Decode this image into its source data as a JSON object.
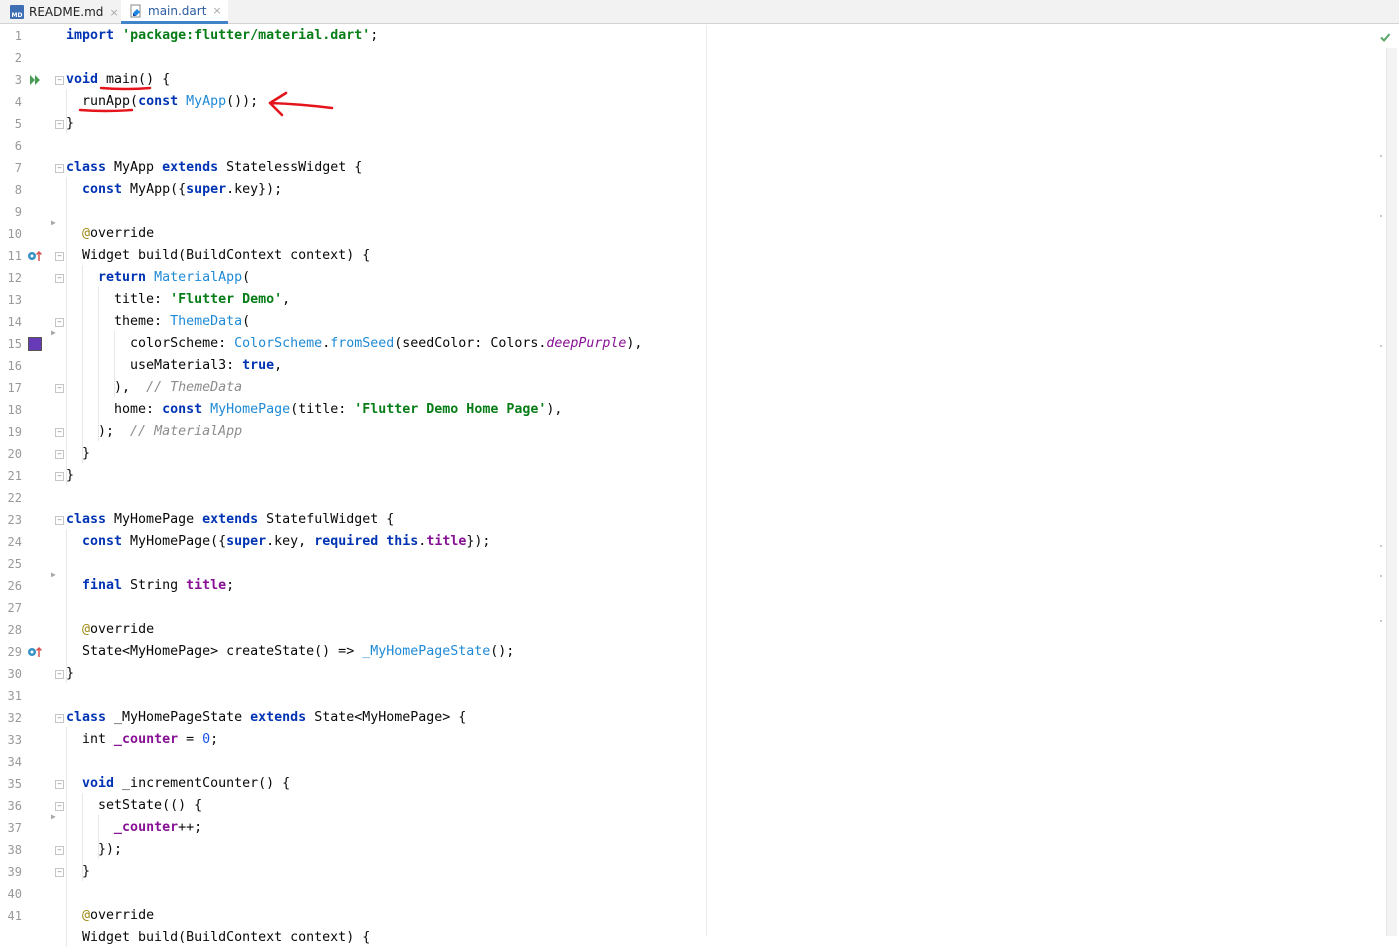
{
  "tabs": [
    {
      "label": "README.md",
      "icon": "markdown-file-icon",
      "active": false
    },
    {
      "label": "main.dart",
      "icon": "dart-file-icon",
      "active": true
    }
  ],
  "tab_close_glyph": "×",
  "editor": {
    "status": "no-problems-check-icon",
    "color_swatch": "#673ab7",
    "accent": "#4083c9"
  },
  "line_numbers": [
    "1",
    "2",
    "3",
    "4",
    "5",
    "6",
    "7",
    "8",
    "9",
    "10",
    "11",
    "12",
    "13",
    "14",
    "15",
    "16",
    "17",
    "18",
    "19",
    "20",
    "21",
    "22",
    "23",
    "24",
    "25",
    "26",
    "27",
    "28",
    "29",
    "30",
    "31",
    "32",
    "33",
    "34",
    "35",
    "36",
    "37",
    "38",
    "39",
    "40",
    "41"
  ],
  "code_lines": [
    [
      [
        "kw",
        "import"
      ],
      [
        "",
        " "
      ],
      [
        "str",
        "'package:flutter/material.dart'"
      ],
      [
        "",
        ";"
      ]
    ],
    [],
    [
      [
        "kw",
        "void"
      ],
      [
        "",
        " main() {"
      ]
    ],
    [
      [
        "",
        "  runApp("
      ],
      [
        "kw",
        "const"
      ],
      [
        "",
        " "
      ],
      [
        "cls",
        "MyApp"
      ],
      [
        "",
        "());"
      ]
    ],
    [
      [
        "",
        "}"
      ]
    ],
    [],
    [
      [
        "kw",
        "class"
      ],
      [
        "",
        " MyApp "
      ],
      [
        "kw",
        "extends"
      ],
      [
        "",
        " StatelessWidget {"
      ]
    ],
    [
      [
        "",
        "  "
      ],
      [
        "kw",
        "const"
      ],
      [
        "",
        " MyApp({"
      ],
      [
        "kw",
        "super"
      ],
      [
        "",
        ".key});"
      ]
    ],
    [],
    [
      [
        "ann",
        "  @"
      ],
      [
        "",
        "override"
      ]
    ],
    [
      [
        "",
        "  Widget build(BuildContext context) {"
      ]
    ],
    [
      [
        "",
        "    "
      ],
      [
        "kw",
        "return"
      ],
      [
        "",
        " "
      ],
      [
        "cls",
        "MaterialApp"
      ],
      [
        "",
        "("
      ]
    ],
    [
      [
        "",
        "      title: "
      ],
      [
        "str",
        "'Flutter Demo'"
      ],
      [
        "",
        ","
      ]
    ],
    [
      [
        "",
        "      theme: "
      ],
      [
        "cls",
        "ThemeData"
      ],
      [
        "",
        "("
      ]
    ],
    [
      [
        "",
        "        colorScheme: "
      ],
      [
        "cls",
        "ColorScheme"
      ],
      [
        "",
        "."
      ],
      [
        "cls",
        "fromSeed"
      ],
      [
        "",
        "(seedColor: Colors."
      ],
      [
        "fldi",
        "deepPurple"
      ],
      [
        "",
        "),"
      ]
    ],
    [
      [
        "",
        "        useMaterial3: "
      ],
      [
        "kw",
        "true"
      ],
      [
        "",
        ","
      ]
    ],
    [
      [
        "",
        "      ),  "
      ],
      [
        "cmt",
        "// ThemeData"
      ]
    ],
    [
      [
        "",
        "      home: "
      ],
      [
        "kw",
        "const"
      ],
      [
        "",
        " "
      ],
      [
        "cls",
        "MyHomePage"
      ],
      [
        "",
        "(title: "
      ],
      [
        "str",
        "'Flutter Demo Home Page'"
      ],
      [
        "",
        "),"
      ]
    ],
    [
      [
        "",
        "    );  "
      ],
      [
        "cmt",
        "// MaterialApp"
      ]
    ],
    [
      [
        "",
        "  }"
      ]
    ],
    [
      [
        "",
        "}"
      ]
    ],
    [],
    [
      [
        "kw",
        "class"
      ],
      [
        "",
        " MyHomePage "
      ],
      [
        "kw",
        "extends"
      ],
      [
        "",
        " StatefulWidget {"
      ]
    ],
    [
      [
        "",
        "  "
      ],
      [
        "kw",
        "const"
      ],
      [
        "",
        " MyHomePage({"
      ],
      [
        "kw",
        "super"
      ],
      [
        "",
        ".key, "
      ],
      [
        "kw",
        "required"
      ],
      [
        "",
        " "
      ],
      [
        "kw",
        "this"
      ],
      [
        "",
        "."
      ],
      [
        "fld",
        "title"
      ],
      [
        "",
        "});"
      ]
    ],
    [],
    [
      [
        "",
        "  "
      ],
      [
        "kw",
        "final"
      ],
      [
        "",
        " String "
      ],
      [
        "fld",
        "title"
      ],
      [
        "",
        ";"
      ]
    ],
    [],
    [
      [
        "ann",
        "  @"
      ],
      [
        "",
        "override"
      ]
    ],
    [
      [
        "",
        "  State<MyHomePage> createState() => "
      ],
      [
        "cls",
        "_MyHomePageState"
      ],
      [
        "",
        "();"
      ]
    ],
    [
      [
        "",
        "}"
      ]
    ],
    [],
    [
      [
        "kw",
        "class"
      ],
      [
        "",
        " _MyHomePageState "
      ],
      [
        "kw",
        "extends"
      ],
      [
        "",
        " State<MyHomePage> {"
      ]
    ],
    [
      [
        "",
        "  int "
      ],
      [
        "fld",
        "_counter"
      ],
      [
        "",
        " = "
      ],
      [
        "num",
        "0"
      ],
      [
        "",
        ";"
      ]
    ],
    [],
    [
      [
        "",
        "  "
      ],
      [
        "kw",
        "void"
      ],
      [
        "",
        " _incrementCounter() {"
      ]
    ],
    [
      [
        "",
        "    setState(() {"
      ]
    ],
    [
      [
        "",
        "      "
      ],
      [
        "fld",
        "_counter"
      ],
      [
        "",
        "++;"
      ]
    ],
    [
      [
        "",
        "    });"
      ]
    ],
    [
      [
        "",
        "  }"
      ]
    ],
    [],
    [
      [
        "ann",
        "  @"
      ],
      [
        "",
        "override"
      ]
    ],
    [
      [
        "",
        "  Widget build(BuildContext context) {"
      ]
    ]
  ]
}
